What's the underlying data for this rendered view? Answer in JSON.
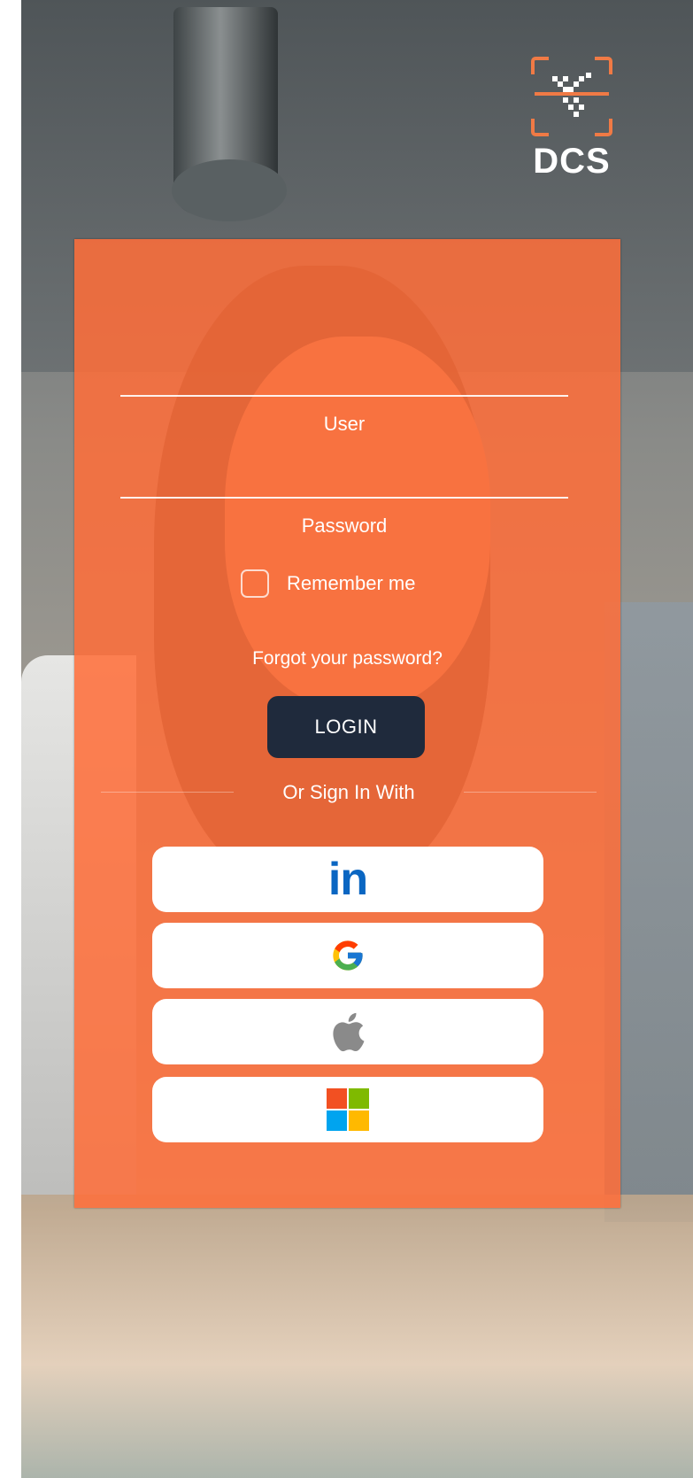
{
  "brand": {
    "name": "DCS"
  },
  "login_form": {
    "user_label": "User",
    "password_label": "Password",
    "remember_label": "Remember me",
    "remember_checked": false,
    "forgot_label": "Forgot your password?",
    "login_label": "LOGIN",
    "divider_label": "Or Sign In With"
  },
  "social": [
    {
      "name": "linkedin",
      "icon": "linkedin-icon",
      "text": "in",
      "color": "#0a66c2"
    },
    {
      "name": "google",
      "icon": "google-icon"
    },
    {
      "name": "apple",
      "icon": "apple-icon"
    },
    {
      "name": "microsoft",
      "icon": "microsoft-icon"
    }
  ],
  "colors": {
    "accent": "#ff6d39",
    "button_dark": "#1f2a3c"
  }
}
